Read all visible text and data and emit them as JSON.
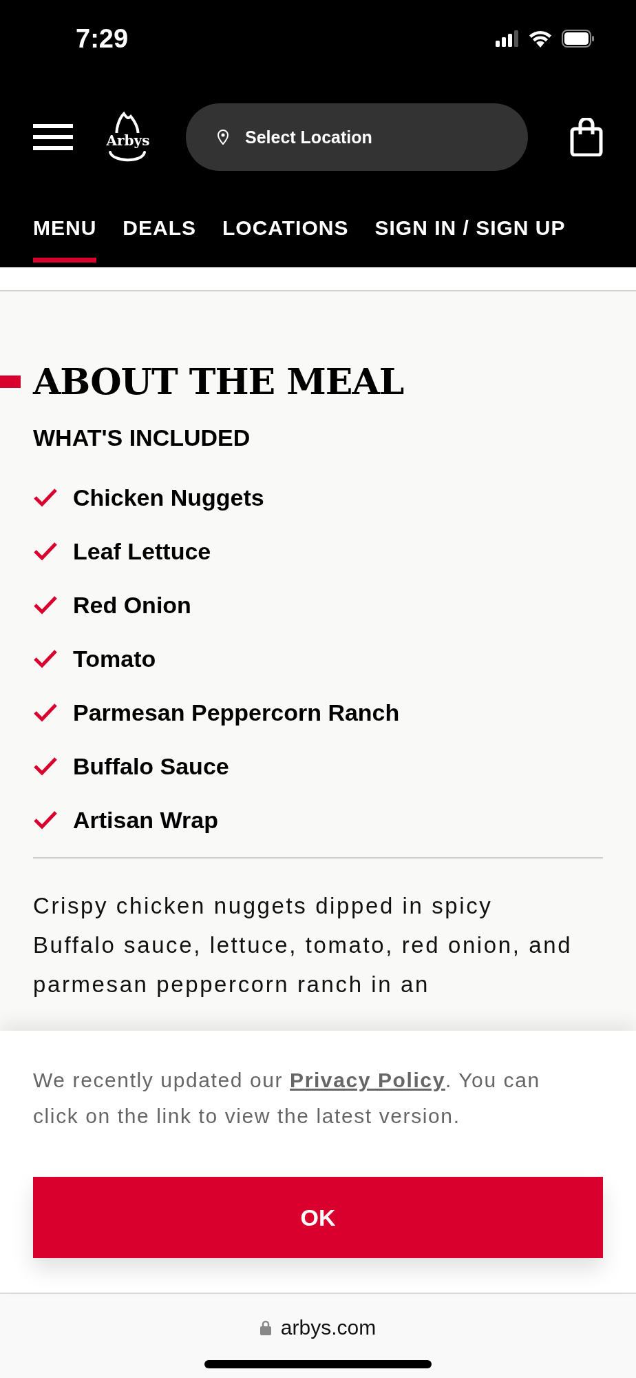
{
  "status_bar": {
    "time": "7:29"
  },
  "header": {
    "logo_text": "Arbys",
    "location_button": "Select Location"
  },
  "nav": [
    {
      "label": "MENU",
      "selected": true
    },
    {
      "label": "DEALS",
      "selected": false
    },
    {
      "label": "LOCATIONS",
      "selected": false
    },
    {
      "label": "SIGN IN / SIGN UP",
      "selected": false
    }
  ],
  "section": {
    "title": "ABOUT THE MEAL",
    "subtitle": "WHAT'S INCLUDED",
    "items": [
      "Chicken Nuggets",
      "Leaf Lettuce",
      "Red Onion",
      "Tomato",
      "Parmesan Peppercorn Ranch",
      "Buffalo Sauce",
      "Artisan Wrap"
    ],
    "description": "Crispy chicken nuggets dipped in spicy Buffalo sauce, lettuce, tomato, red onion, and parmesan peppercorn ranch in an"
  },
  "notice": {
    "text_before": "We recently updated our ",
    "link": "Privacy Policy",
    "text_after": ". You can click on the link to view the latest version.",
    "button": "OK"
  },
  "browser_bar": {
    "url": "arbys.com"
  }
}
